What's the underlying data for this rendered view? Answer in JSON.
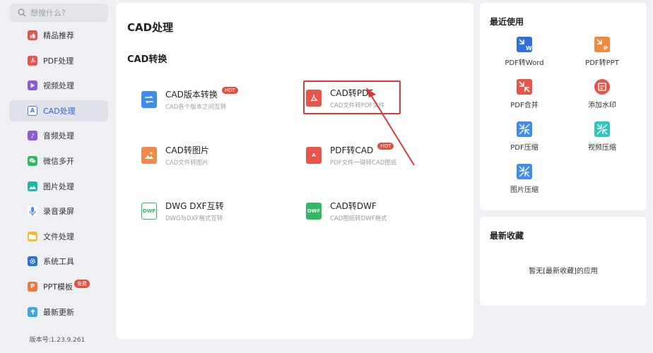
{
  "search": {
    "placeholder": "想搜什么?"
  },
  "sidebar": {
    "items": [
      {
        "label": "精品推荐",
        "icon": "thumbs-up-icon",
        "color": "#e8534a"
      },
      {
        "label": "PDF处理",
        "icon": "pdf-icon",
        "color": "#e8534a"
      },
      {
        "label": "视频处理",
        "icon": "video-icon",
        "color": "#8e5bd6"
      },
      {
        "label": "CAD处理",
        "icon": "cad-icon",
        "color": "#3f7ee8",
        "active": true
      },
      {
        "label": "音频处理",
        "icon": "music-icon",
        "color": "#8e5bd6"
      },
      {
        "label": "微信多开",
        "icon": "wechat-icon",
        "color": "#2dbb5f"
      },
      {
        "label": "图片处理",
        "icon": "image-icon",
        "color": "#1fb5a8"
      },
      {
        "label": "录音录屏",
        "icon": "microphone-icon",
        "color": "#4a8ef0"
      },
      {
        "label": "文件处理",
        "icon": "folder-icon",
        "color": "#f5b82e"
      },
      {
        "label": "系统工具",
        "icon": "gear-icon",
        "color": "#2a6fd6"
      },
      {
        "label": "PPT模板",
        "icon": "ppt-icon",
        "color": "#ef7a3c",
        "badge": "免费"
      },
      {
        "label": "最新更新",
        "icon": "upload-icon",
        "color": "#3aa7e0"
      }
    ],
    "version": "版本号:1.23.9.261"
  },
  "main": {
    "title": "CAD处理",
    "section": "CAD转换",
    "tools": [
      {
        "name": "CAD版本转换",
        "desc": "CAD各个版本之间互转",
        "hot": "HOT",
        "icon": "cad-version-icon"
      },
      {
        "name": "CAD转PDF",
        "desc": "CAD文件转PDF文件",
        "icon": "cad-to-pdf-icon"
      },
      {
        "name": "CAD转图片",
        "desc": "CAD文件转图片",
        "icon": "cad-to-image-icon"
      },
      {
        "name": "PDF转CAD",
        "desc": "PDF文件一键转CAD图纸",
        "hot": "HOT",
        "icon": "pdf-to-cad-icon"
      },
      {
        "name": "DWG DXF互转",
        "desc": "DWG与DXF格式互转",
        "icon": "dwg-dxf-icon"
      },
      {
        "name": "CAD转DWF",
        "desc": "CAD图纸转DWF格式",
        "icon": "cad-to-dwf-icon"
      }
    ]
  },
  "recent": {
    "title": "最近使用",
    "items": [
      {
        "label": "PDF转Word",
        "icon": "pdf-to-word-icon"
      },
      {
        "label": "PDF转PPT",
        "icon": "pdf-to-ppt-icon"
      },
      {
        "label": "PDF合并",
        "icon": "pdf-merge-icon"
      },
      {
        "label": "添加水印",
        "icon": "watermark-icon"
      },
      {
        "label": "PDF压缩",
        "icon": "pdf-compress-icon"
      },
      {
        "label": "视频压缩",
        "icon": "video-compress-icon"
      },
      {
        "label": "图片压缩",
        "icon": "image-compress-icon"
      }
    ]
  },
  "favorites": {
    "title": "最新收藏",
    "empty": "暂无[最新收藏]的应用"
  }
}
